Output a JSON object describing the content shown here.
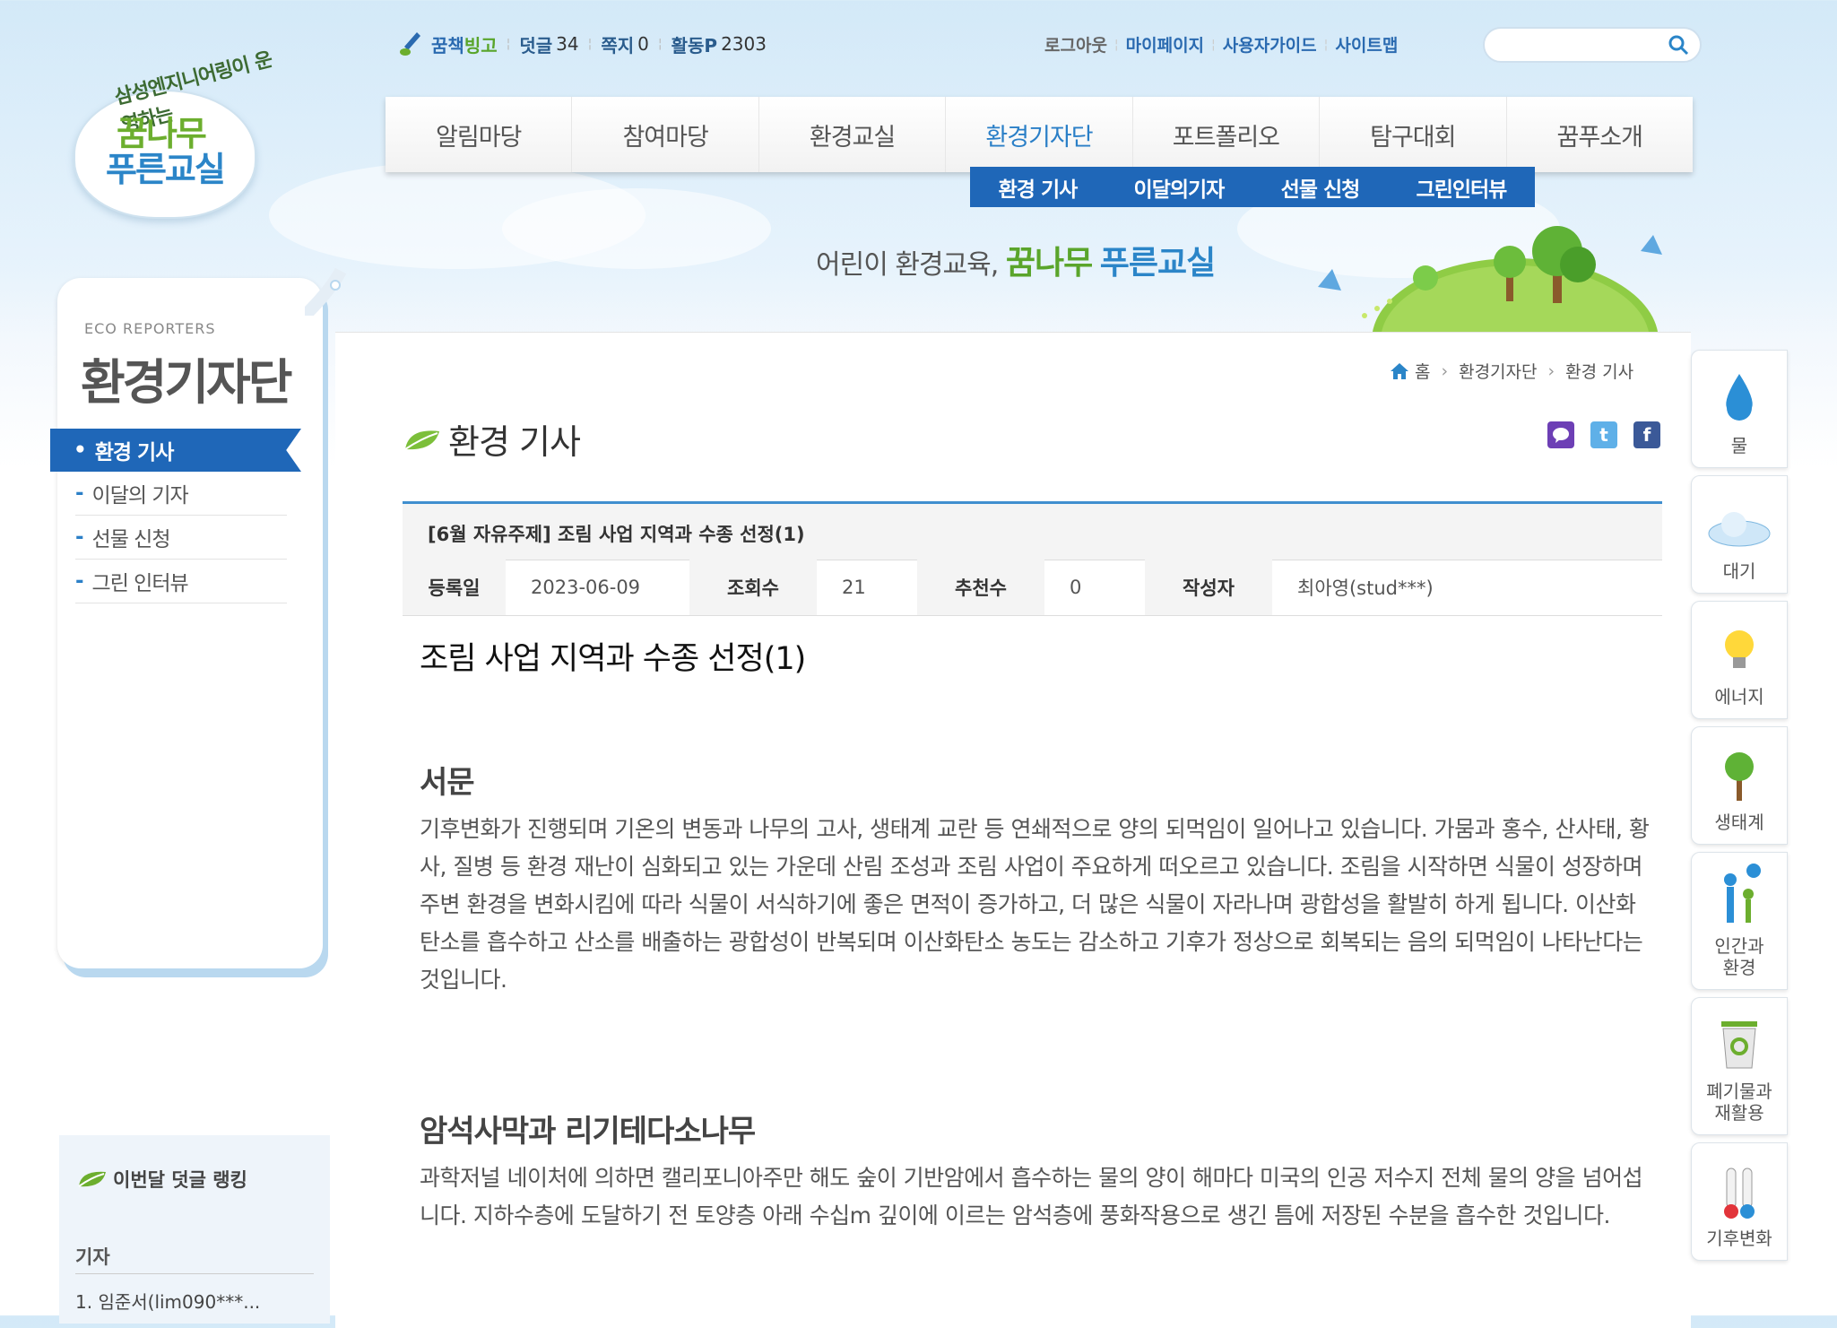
{
  "logo": {
    "tagline": "삼성엔지니어링이 운영하는",
    "line1": "꿈나무",
    "line2": "푸른교실"
  },
  "userbar": {
    "brand_part1": "꿈책",
    "brand_part2": "빙고",
    "comments_label": "덧글",
    "comments_count": "34",
    "notes_label": "쪽지",
    "notes_count": "0",
    "activity_label": "활동P",
    "activity_count": "2303"
  },
  "toplinks": [
    "로그아웃",
    "마이페이지",
    "사용자가이드",
    "사이트맵"
  ],
  "search": {
    "placeholder": ""
  },
  "mainnav": [
    "알림마당",
    "참여마당",
    "환경교실",
    "환경기자단",
    "포트폴리오",
    "탐구대회",
    "꿈푸소개"
  ],
  "subnav": [
    "환경 기사",
    "이달의기자",
    "선물 신청",
    "그린인터뷰"
  ],
  "banner": {
    "slogan": "어린이 환경교육,",
    "slogan_green": "꿈나무",
    "slogan_blue": "푸른교실"
  },
  "leftpanel": {
    "eco": "ECO REPORTERS",
    "title": "환경기자단",
    "menu": [
      "환경 기사",
      "이달의 기자",
      "선물 신청",
      "그린 인터뷰"
    ]
  },
  "ranking": {
    "title": "이번달 덧글 랭킹",
    "column": "기자",
    "first": "1. 임준서(lim090***..."
  },
  "breadcrumb": [
    "홈",
    "환경기자단",
    "환경 기사"
  ],
  "page_heading": "환경 기사",
  "article": {
    "title_bar": "[6월 자유주제] 조림 사업 지역과 수종 선정(1)",
    "meta": {
      "date_label": "등록일",
      "date": "2023-06-09",
      "views_label": "조회수",
      "views": "21",
      "likes_label": "추천수",
      "likes": "0",
      "author_label": "작성자",
      "author": "최아영(stud***)"
    },
    "heading": "조림 사업 지역과 수종 선정(1)",
    "section1_title": "서문",
    "section1_body": "기후변화가 진행되며 기온의 변동과 나무의 고사, 생태계 교란 등 연쇄적으로 양의 되먹임이 일어나고 있습니다. 가뭄과 홍수, 산사태, 황사, 질병 등 환경 재난이 심화되고 있는 가운데 산림 조성과 조림 사업이 주요하게 떠오르고 있습니다. 조림을 시작하면 식물이 성장하며 주변 환경을 변화시킴에 따라 식물이 서식하기에 좋은 면적이 증가하고, 더 많은 식물이 자라나며 광합성을 활발히 하게 됩니다. 이산화탄소를 흡수하고 산소를 배출하는 광합성이 반복되며 이산화탄소 농도는 감소하고 기후가 정상으로 회복되는 음의 되먹임이 나타난다는 것입니다.",
    "section2_title": "암석사막과 리기테다소나무",
    "section2_body": "과학저널 네이처에 의하면 캘리포니아주만 해도 숲이 기반암에서 흡수하는 물의 양이 해마다 미국의 인공 저수지 전체 물의 양을 넘어섭니다. 지하수층에 도달하기 전 토양층 아래 수십m 깊이에 이르는 암석층에 풍화작용으로 생긴 틈에 저장된 수분을 흡수한 것입니다."
  },
  "quickmenu": [
    "물",
    "대기",
    "에너지",
    "생태계",
    "인간과\n환경",
    "폐기물과\n재활용",
    "기후변화"
  ],
  "colors": {
    "accent_blue": "#1f67b8",
    "brand_green": "#6cae2e",
    "line_blue": "#3f8fcf"
  }
}
